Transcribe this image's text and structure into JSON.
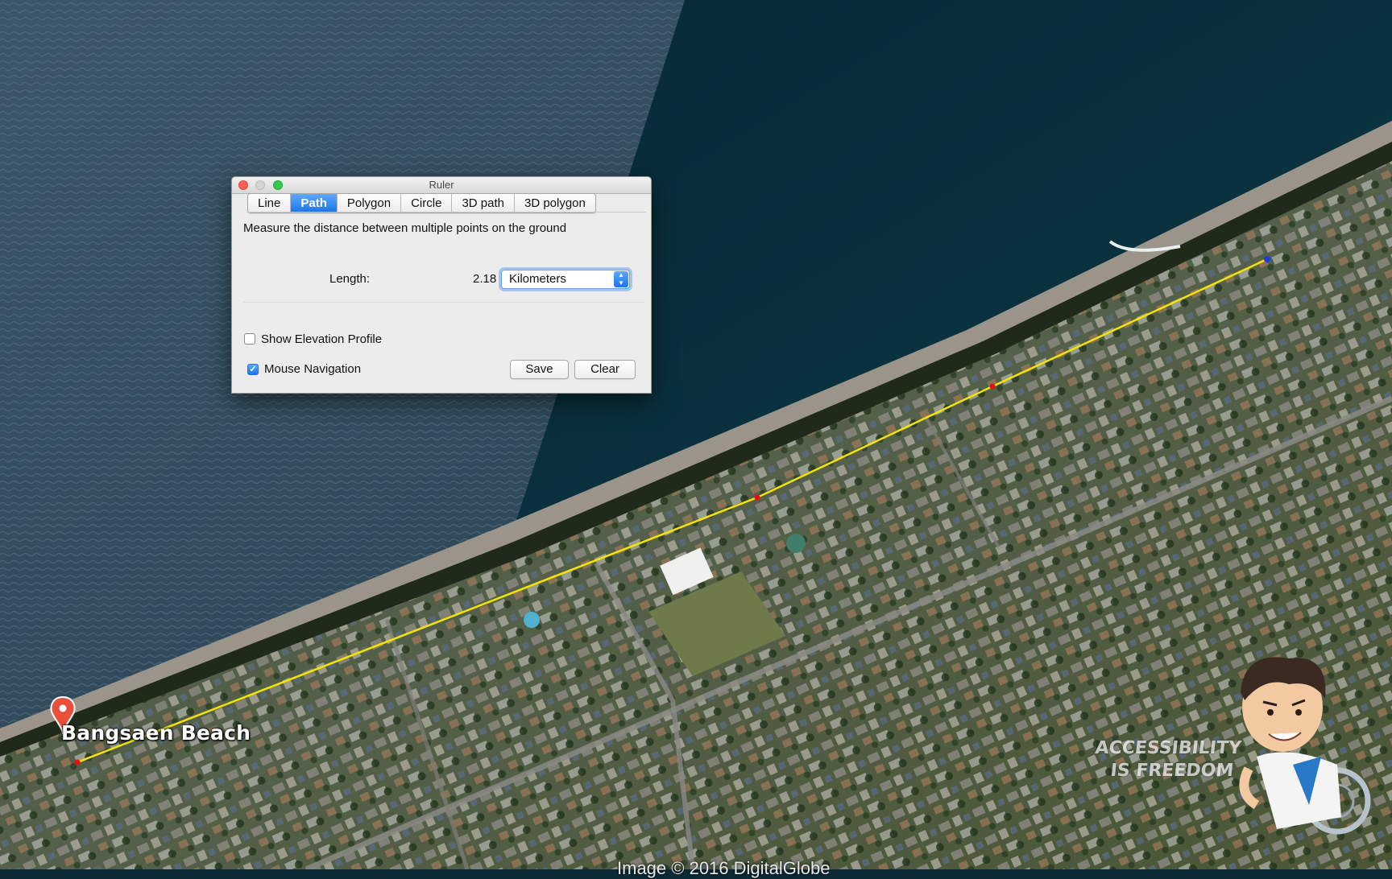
{
  "map": {
    "placemark_label": "Bangsaen Beach",
    "imagery_credit": "Image © 2016 DigitalGlobe",
    "watermark_line1": "ACCESSIBILITY",
    "watermark_line2": "IS FREEDOM",
    "path_color": "#f5e400",
    "vertex_color": "#e81010",
    "end_vertex_color": "#1f3bd8"
  },
  "ruler": {
    "title": "Ruler",
    "tabs": [
      {
        "label": "Line",
        "active": false
      },
      {
        "label": "Path",
        "active": true
      },
      {
        "label": "Polygon",
        "active": false
      },
      {
        "label": "Circle",
        "active": false
      },
      {
        "label": "3D path",
        "active": false
      },
      {
        "label": "3D polygon",
        "active": false
      }
    ],
    "description": "Measure the distance between multiple points on the ground",
    "length_label": "Length:",
    "length_value": "2.18",
    "unit": "Kilometers",
    "show_elevation_label": "Show Elevation Profile",
    "show_elevation_checked": false,
    "mouse_navigation_label": "Mouse Navigation",
    "mouse_navigation_checked": true,
    "save_label": "Save",
    "clear_label": "Clear",
    "accent": "#1a74ec"
  }
}
